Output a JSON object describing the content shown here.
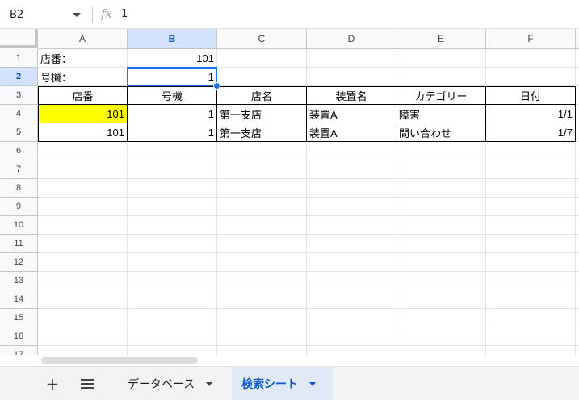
{
  "formula_bar": {
    "cell_ref": "B2",
    "fx_symbol": "fx",
    "value": "1"
  },
  "columns": [
    "A",
    "B",
    "C",
    "D",
    "E",
    "F"
  ],
  "rows": [
    "1",
    "2",
    "3",
    "4",
    "5",
    "6",
    "7",
    "8",
    "9",
    "10",
    "11",
    "12",
    "13",
    "14",
    "15",
    "16",
    "17"
  ],
  "selected_cell": "B2",
  "cells": {
    "A1": "店番：",
    "B1": "101",
    "A2": "号機：",
    "B2": "1",
    "A3": "店番",
    "B3": "号機",
    "C3": "店名",
    "D3": "装置名",
    "E3": "カテゴリー",
    "F3": "日付",
    "A4": "101",
    "B4": "1",
    "C4": "第一支店",
    "D4": "装置A",
    "E4": "障害",
    "F4": "1/1",
    "A5": "101",
    "B5": "1",
    "C5": "第一支店",
    "D5": "装置A",
    "E5": "問い合わせ",
    "F5": "1/7"
  },
  "highlight_color": "#ffff00",
  "accent_color": "#1a73e8",
  "sheet_tabs": [
    {
      "label": "データベース",
      "active": false
    },
    {
      "label": "検索シート",
      "active": true
    }
  ],
  "tab_controls": {
    "add_label": "+",
    "add_icon": "plus-icon",
    "list_icon": "menu-icon"
  }
}
